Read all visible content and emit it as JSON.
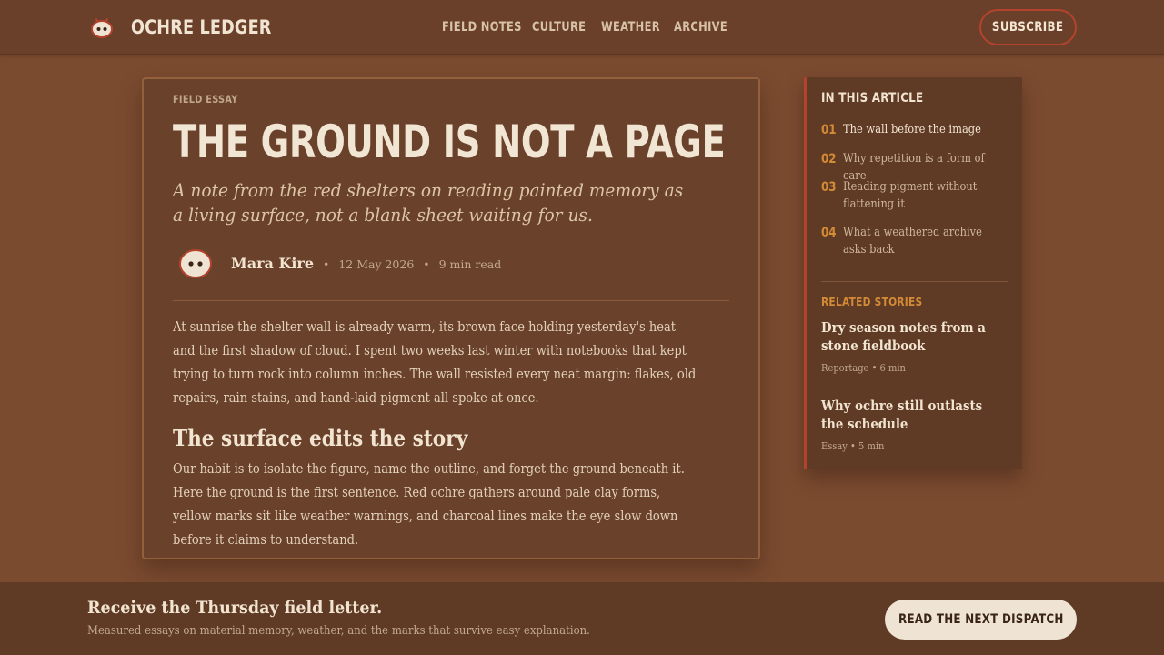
{
  "header": {
    "brand": "OCHRE LEDGER",
    "logo_icon": "beetle-mask-icon",
    "nav": [
      {
        "label": "FIELD NOTES"
      },
      {
        "label": "CULTURE"
      },
      {
        "label": "WEATHER"
      },
      {
        "label": "ARCHIVE"
      }
    ],
    "subscribe_label": "SUBSCRIBE"
  },
  "article": {
    "eyebrow": "FIELD ESSAY",
    "title": "THE GROUND IS NOT A PAGE",
    "dek": "A note from the red shelters on reading painted memory as a living surface, not a blank sheet waiting for us.",
    "author": "Mara Kire",
    "date": "12 May 2026",
    "read_time": "9 min read",
    "paragraph_1": "At sunrise the shelter wall is already warm, its brown face holding yesterday's heat and the first shadow of cloud. I spent two weeks last winter with notebooks that kept trying to turn rock into column inches. The wall resisted every neat margin: flakes, old repairs, rain stains, and hand-laid pigment all spoke at once.",
    "subheading": "The surface edits the story",
    "paragraph_2": "Our habit is to isolate the figure, name the outline, and forget the ground beneath it. Here the ground is the first sentence. Red ochre gathers around pale clay forms, yellow marks sit like weather warnings, and charcoal lines make the eye slow down before it claims to understand."
  },
  "sidebar": {
    "toc_title": "IN THIS ARTICLE",
    "toc": [
      {
        "num": "01",
        "text": "The wall before the image"
      },
      {
        "num": "02",
        "text": "Why repetition is a form of care"
      },
      {
        "num": "03",
        "text": "Reading pigment without flattening it"
      },
      {
        "num": "04",
        "text": "What a weathered archive asks back"
      }
    ],
    "related_title": "RELATED STORIES",
    "related": [
      {
        "title": "Dry season notes from a stone fieldbook",
        "meta": "Reportage • 6 min"
      },
      {
        "title": "Why ochre still outlasts the schedule",
        "meta": "Essay • 5 min"
      }
    ]
  },
  "footer": {
    "title": "Receive the Thursday field letter.",
    "subtitle": "Measured essays on material memory, weather, and the marks that survive easy explanation.",
    "cta_label": "READ THE NEXT DISPATCH"
  },
  "colors": {
    "background": "#7b4b30",
    "accent_red": "#b4432e",
    "accent_ochre": "#d38b36",
    "cream": "#efe4d3"
  }
}
